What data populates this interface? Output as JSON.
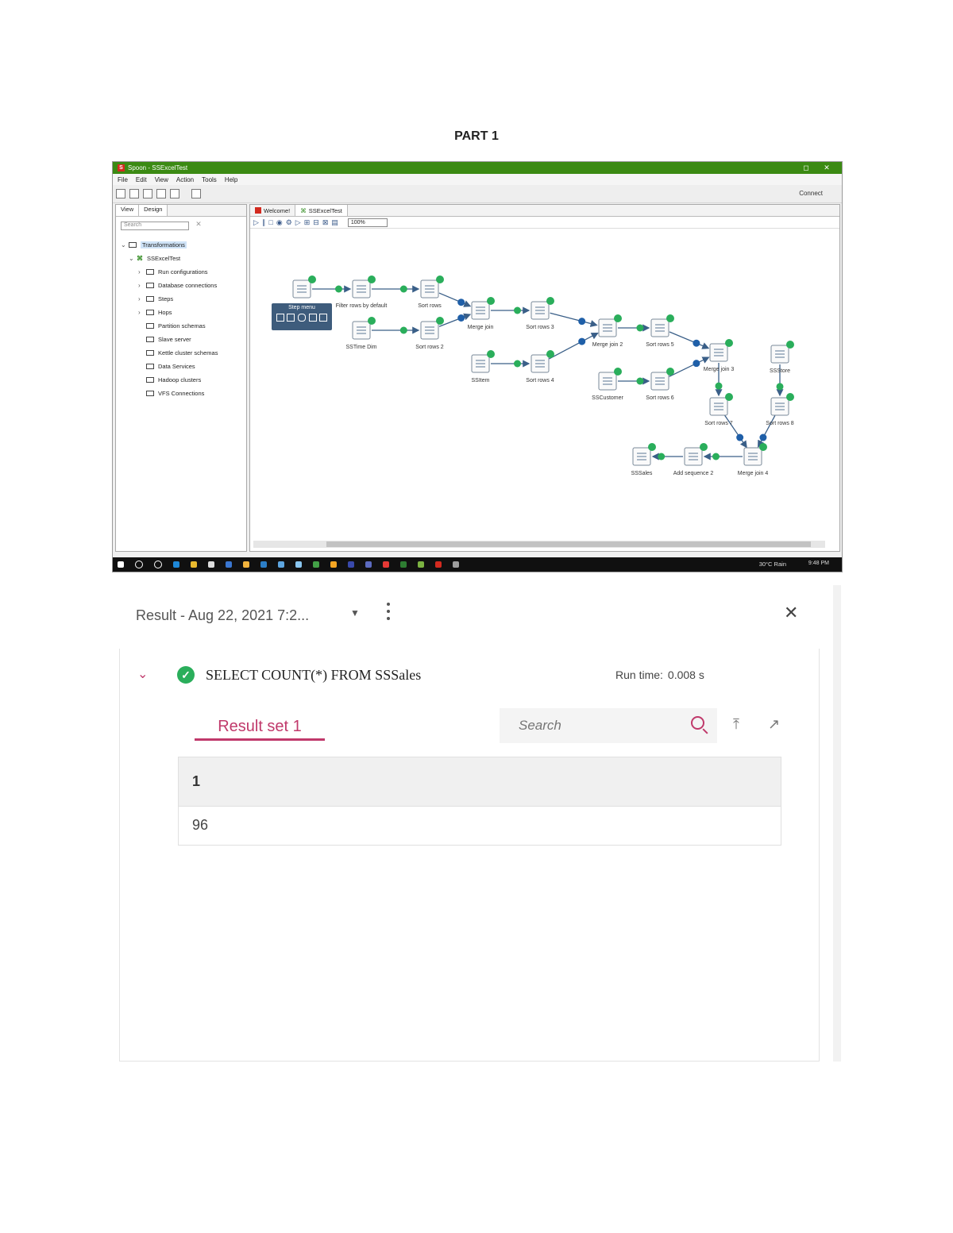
{
  "heading": "PART 1",
  "spoon": {
    "title": "Spoon - SSExcelTest",
    "window_controls": [
      "◻",
      "✕"
    ],
    "menu": [
      "File",
      "Edit",
      "View",
      "Action",
      "Tools",
      "Help"
    ],
    "connect": "Connect",
    "left_tabs": [
      "View",
      "Design"
    ],
    "search_placeholder": "Search",
    "tree": {
      "root": "Transformations",
      "transform": "SSExcelTest",
      "items": [
        "Run configurations",
        "Database connections",
        "Steps",
        "Hops",
        "Partition schemas",
        "Slave server",
        "Kettle cluster schemas",
        "Data Services",
        "Hadoop clusters",
        "VFS Connections"
      ]
    },
    "editor_tabs": [
      "Welcome!",
      "SSExcelTest"
    ],
    "zoom": "100%",
    "tooltip_label": "Step menu",
    "steps": [
      {
        "label": "",
        "icon": "excel-input-icon"
      },
      {
        "label": "Filter rows by default",
        "icon": "filter-icon"
      },
      {
        "label": "Sort rows",
        "icon": "sort-icon"
      },
      {
        "label": "SSTime Dim",
        "icon": "table-input-icon"
      },
      {
        "label": "Sort rows 2",
        "icon": "sort-icon"
      },
      {
        "label": "Merge join",
        "icon": "merge-icon"
      },
      {
        "label": "Sort rows 3",
        "icon": "sort-icon"
      },
      {
        "label": "SSItem",
        "icon": "table-input-icon"
      },
      {
        "label": "Sort rows 4",
        "icon": "sort-icon"
      },
      {
        "label": "Merge join 2",
        "icon": "merge-icon"
      },
      {
        "label": "Sort rows 5",
        "icon": "sort-icon"
      },
      {
        "label": "SSCustomer",
        "icon": "table-input-icon"
      },
      {
        "label": "Sort rows 6",
        "icon": "sort-icon"
      },
      {
        "label": "Merge join 3",
        "icon": "merge-icon"
      },
      {
        "label": "SSStore",
        "icon": "table-input-icon"
      },
      {
        "label": "Sort rows 7",
        "icon": "sort-icon"
      },
      {
        "label": "Sort rows 8",
        "icon": "sort-icon"
      },
      {
        "label": "Merge join 4",
        "icon": "merge-icon"
      },
      {
        "label": "Add sequence 2",
        "icon": "sequence-icon"
      },
      {
        "label": "SSSales",
        "icon": "table-output-icon"
      }
    ],
    "taskbar": {
      "weather": "30°C Rain",
      "clock": "9:48 PM"
    }
  },
  "result": {
    "header": "Result - Aug 22, 2021 7:2...",
    "query": "SELECT COUNT(*) FROM SSSales",
    "run_time_label": "Run time:",
    "run_time_value": "0.008 s",
    "tab": "Result set 1",
    "search_placeholder": "Search",
    "columns": [
      "1"
    ],
    "rows": [
      [
        "96"
      ]
    ]
  },
  "colors": {
    "accent": "#c0396b",
    "success": "#2aae5b",
    "spoon_title": "#3b8a13"
  }
}
